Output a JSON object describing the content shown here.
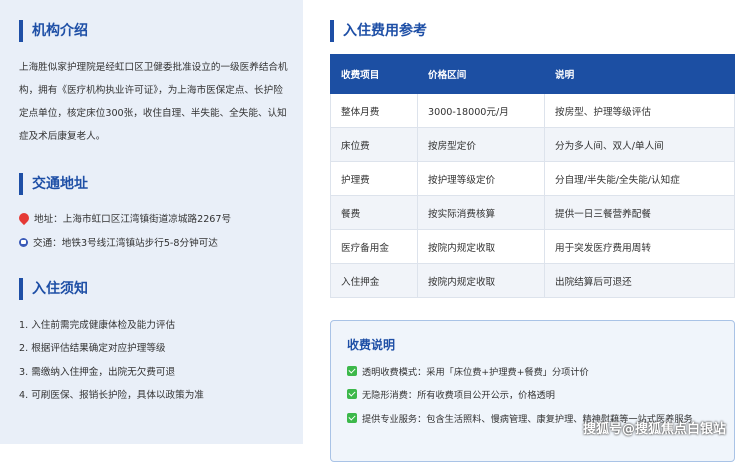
{
  "intro": {
    "title": "机构介绍",
    "text": "上海胜似家护理院是经虹口区卫健委批准设立的一级医养结合机构，拥有《医疗机构执业许可证》，为上海市医保定点、长护险定点单位，核定床位300张，收住自理、半失能、全失能、认知症及术后康复老人。"
  },
  "traffic": {
    "title": "交通地址",
    "address": "地址：上海市虹口区江湾镇街道凉城路2267号",
    "transport": "交通：地铁3号线江湾镇站步行5-8分钟可达"
  },
  "admission": {
    "title": "入住须知",
    "items": [
      "1. 入住前需完成健康体检及能力评估",
      "2. 根据评估结果确定对应护理等级",
      "3. 需缴纳入住押金，出院无欠费可退",
      "4. 可刷医保、报销长护险，具体以政策为准"
    ]
  },
  "fees": {
    "title": "入住费用参考",
    "headers": [
      "收费项目",
      "价格区间",
      "说明"
    ],
    "rows": [
      [
        "整体月费",
        "3000-18000元/月",
        "按房型、护理等级评估"
      ],
      [
        "床位费",
        "按房型定价",
        "分为多人间、双人/单人间"
      ],
      [
        "护理费",
        "按护理等级定价",
        "分自理/半失能/全失能/认知症"
      ],
      [
        "餐费",
        "按实际消费核算",
        "提供一日三餐营养配餐"
      ],
      [
        "医疗备用金",
        "按院内规定收取",
        "用于突发医疗费用周转"
      ],
      [
        "入住押金",
        "按院内规定收取",
        "出院结算后可退还"
      ]
    ]
  },
  "notes": {
    "title": "收费说明",
    "items": [
      "透明收费模式：采用「床位费+护理费+餐费」分项计价",
      "无隐形消费：所有收费项目公开公示，价格透明",
      "提供专业服务：包含生活照料、慢病管理、康复护理、精神慰藉等一站式医养服务"
    ]
  },
  "watermark": "搜狐号@搜狐焦点白银站",
  "colors": {
    "accent": "#1e4fa6",
    "header_bg": "#1c4fa3",
    "sidebar_bg": "#e9eff8",
    "check": "#3cb84a"
  }
}
